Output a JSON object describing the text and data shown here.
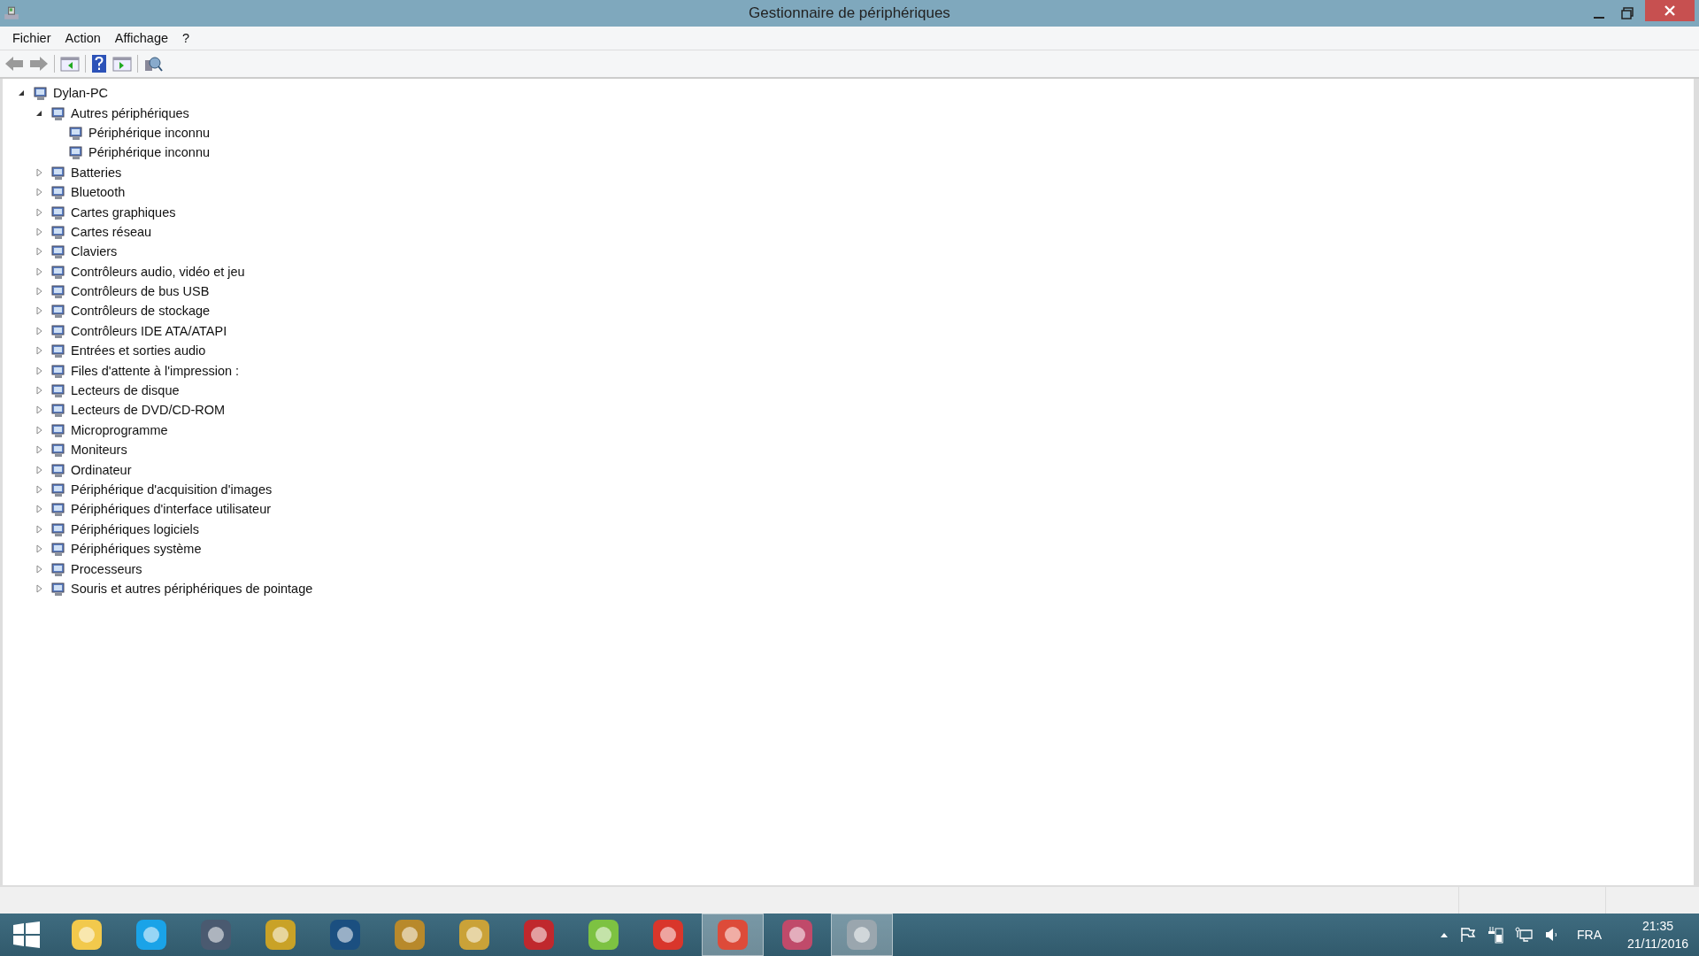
{
  "window": {
    "title": "Gestionnaire de périphériques"
  },
  "menu": [
    "Fichier",
    "Action",
    "Affichage",
    "?"
  ],
  "tree": [
    {
      "label": "Dylan-PC",
      "expanded": true,
      "children": [
        {
          "label": "Autres périphériques",
          "expanded": true,
          "children": [
            {
              "label": "Périphérique inconnu"
            },
            {
              "label": "Périphérique inconnu"
            }
          ]
        },
        {
          "label": "Batteries",
          "expanded": false
        },
        {
          "label": "Bluetooth",
          "expanded": false
        },
        {
          "label": "Cartes graphiques",
          "expanded": false
        },
        {
          "label": "Cartes réseau",
          "expanded": false
        },
        {
          "label": "Claviers",
          "expanded": false
        },
        {
          "label": "Contrôleurs audio, vidéo et jeu",
          "expanded": false
        },
        {
          "label": "Contrôleurs de bus USB",
          "expanded": false
        },
        {
          "label": "Contrôleurs de stockage",
          "expanded": false
        },
        {
          "label": "Contrôleurs IDE ATA/ATAPI",
          "expanded": false
        },
        {
          "label": "Entrées et sorties audio",
          "expanded": false
        },
        {
          "label": "Files d'attente à l'impression :",
          "expanded": false
        },
        {
          "label": "Lecteurs de disque",
          "expanded": false
        },
        {
          "label": "Lecteurs de DVD/CD-ROM",
          "expanded": false
        },
        {
          "label": "Microprogramme",
          "expanded": false
        },
        {
          "label": "Moniteurs",
          "expanded": false
        },
        {
          "label": "Ordinateur",
          "expanded": false
        },
        {
          "label": "Périphérique d'acquisition d'images",
          "expanded": false
        },
        {
          "label": "Périphériques d'interface utilisateur",
          "expanded": false
        },
        {
          "label": "Périphériques logiciels",
          "expanded": false
        },
        {
          "label": "Périphériques système",
          "expanded": false
        },
        {
          "label": "Processeurs",
          "expanded": false
        },
        {
          "label": "Souris et autres périphériques de pointage",
          "expanded": false
        }
      ]
    }
  ],
  "taskbar": {
    "apps": [
      {
        "selected": false
      },
      {
        "selected": false
      },
      {
        "selected": false
      },
      {
        "selected": false
      },
      {
        "selected": false
      },
      {
        "selected": false
      },
      {
        "selected": false
      },
      {
        "selected": false
      },
      {
        "selected": false
      },
      {
        "selected": false
      },
      {
        "selected": true
      },
      {
        "selected": false
      },
      {
        "selected": true
      }
    ],
    "language": "FRA",
    "time": "21:35",
    "date": "21/11/2016"
  }
}
